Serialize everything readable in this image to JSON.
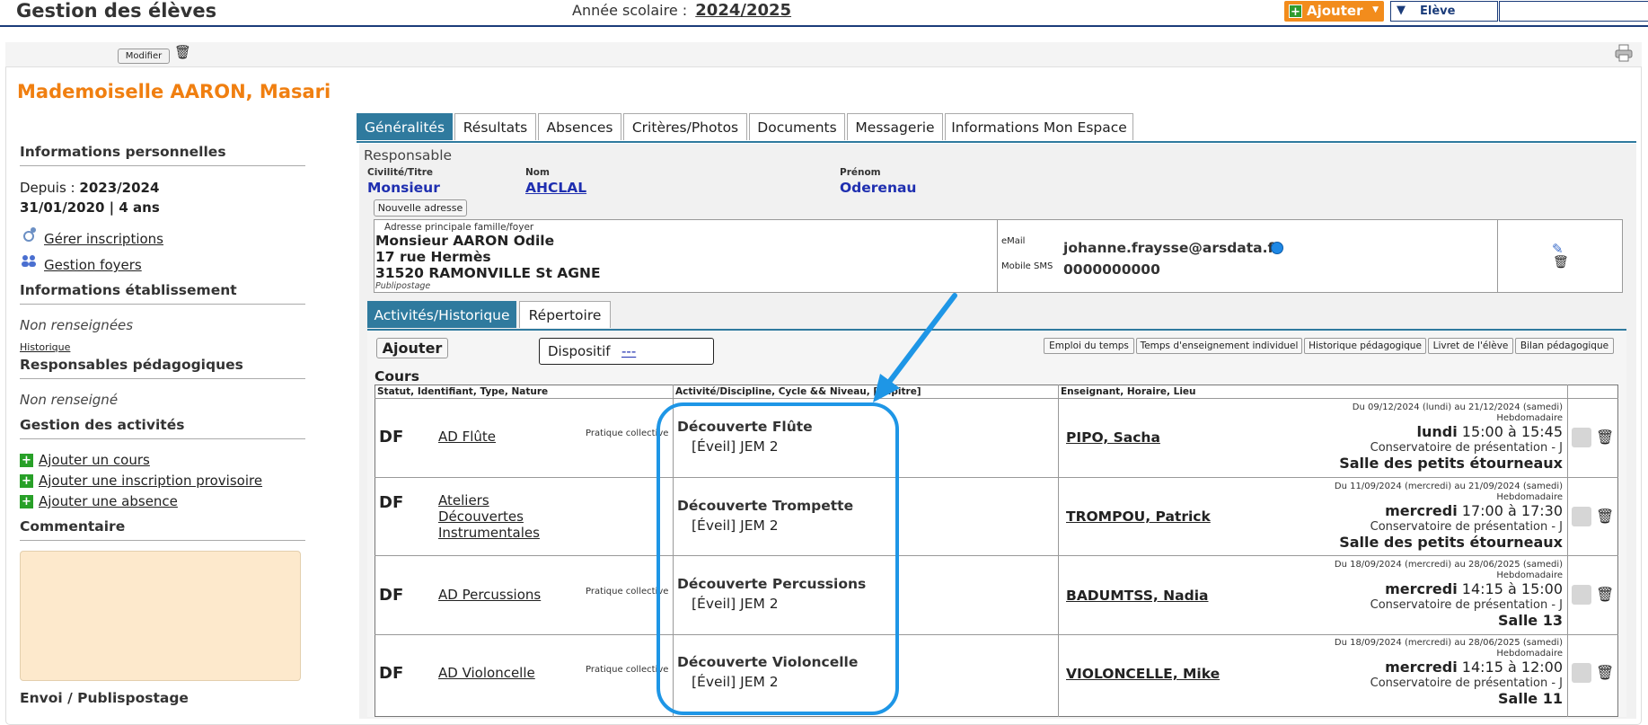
{
  "header": {
    "title": "Gestion des élèves",
    "year_label": "Année scolaire :",
    "year_value": "2024/2025",
    "add_button": "Ajouter",
    "eleve_select": "Elève",
    "search_value": ""
  },
  "toolbar": {
    "modify_label": "Modifier"
  },
  "student": {
    "name": "Mademoiselle  AARON, Masari"
  },
  "left": {
    "perso_title": "Informations personnelles",
    "since_label": "Depuis :",
    "since_value": "2023/2024",
    "birth": "31/01/2020 | 4 ans",
    "manage_enrollments": "Gérer inscriptions",
    "manage_households": "Gestion foyers",
    "etab_title": "Informations établissement",
    "etab_value": "Non renseignées",
    "history_link": "Historique",
    "resp_title": "Responsables pédagogiques",
    "resp_value": "Non renseigné",
    "activities_title": "Gestion des activités",
    "add_course": "Ajouter un cours",
    "add_provisional": "Ajouter une inscription provisoire",
    "add_absence": "Ajouter une absence",
    "comment_title": "Commentaire",
    "mailing_title": "Envoi / Publispostage"
  },
  "tabs": [
    {
      "label": "Généralités"
    },
    {
      "label": "Résultats"
    },
    {
      "label": "Absences"
    },
    {
      "label": "Critères/Photos"
    },
    {
      "label": "Documents"
    },
    {
      "label": "Messagerie"
    },
    {
      "label": "Informations Mon Espace"
    }
  ],
  "responsable": {
    "section_label": "Responsable",
    "civ_label": "Civilité/Titre",
    "civ_value": "Monsieur",
    "nom_label": "Nom",
    "nom_value": "AHCLAL",
    "prenom_label": "Prénom",
    "prenom_value": "Oderenau",
    "new_address": "Nouvelle adresse",
    "address_label": "Adresse principale famille/foyer",
    "address_line1": "Monsieur AARON Odile",
    "address_line2": "17 rue Hermès",
    "address_line3": "31520 RAMONVILLE St AGNE",
    "publipostage": "Publipostage",
    "email_label": "eMail",
    "email_value": "johanne.fraysse@arsdata.fr",
    "sms_label": "Mobile SMS",
    "sms_value": "0000000000"
  },
  "subtabs": [
    {
      "label": "Activités/Historique"
    },
    {
      "label": "Répertoire"
    }
  ],
  "activities": {
    "add_button": "Ajouter",
    "dispositif_label": "Dispositif",
    "dispositif_value": "---",
    "buttons": [
      "Emploi du temps",
      "Temps d'enseignement individuel",
      "Historique pédagogique",
      "Livret de l'élève",
      "Bilan pédagogique"
    ],
    "cours_label": "Cours",
    "col_headers": [
      "Statut, Identifiant, Type, Nature",
      "Activité/Discipline, Cycle && Niveau, [Pupitre]",
      "Enseignant, Horaire, Lieu"
    ]
  },
  "rows": [
    {
      "status": "DF",
      "course": "AD Flûte",
      "nature": "Pratique collective",
      "activity": "Découverte Flûte",
      "level": "[Éveil] JEM 2",
      "teacher": "PIPO, Sacha",
      "period": "Du 09/12/2024 (lundi) au 21/12/2024 (samedi)",
      "frequency": "Hebdomadaire",
      "day": "lundi",
      "hours": "15:00 à 15:45",
      "place": "Conservatoire de présentation - J",
      "room": "Salle des petits étourneaux"
    },
    {
      "status": "DF",
      "course": "Ateliers Découvertes Instrumentales",
      "nature": "",
      "activity": "Découverte Trompette",
      "level": "[Éveil] JEM 2",
      "teacher": "TROMPOU, Patrick",
      "period": "Du 11/09/2024 (mercredi) au 21/09/2024 (samedi)",
      "frequency": "Hebdomadaire",
      "day": "mercredi",
      "hours": "17:00 à 17:30",
      "place": "Conservatoire de présentation - J",
      "room": "Salle des petits étourneaux"
    },
    {
      "status": "DF",
      "course": "AD Percussions",
      "nature": "Pratique collective",
      "activity": "Découverte Percussions",
      "level": "[Éveil] JEM 2",
      "teacher": "BADUMTSS, Nadia",
      "period": "Du 18/09/2024 (mercredi) au 28/06/2025 (samedi)",
      "frequency": "Hebdomadaire",
      "day": "mercredi",
      "hours": "14:15 à 15:00",
      "place": "Conservatoire de présentation - J",
      "room": "Salle 13"
    },
    {
      "status": "DF",
      "course": "AD Violoncelle",
      "nature": "Pratique collective",
      "activity": "Découverte Violoncelle",
      "level": "[Éveil] JEM 2",
      "teacher": "VIOLONCELLE, Mike",
      "period": "Du 18/09/2024 (mercredi) au 28/06/2025 (samedi)",
      "frequency": "Hebdomadaire",
      "day": "mercredi",
      "hours": "14:15 à 12:00",
      "place": "Conservatoire de présentation - J",
      "room": "Salle 11"
    }
  ],
  "colors": {
    "accent": "#f07f10",
    "tab_active": "#2f7a9e",
    "annotation": "#1e96e6",
    "link_blue": "#1f2fb0"
  }
}
